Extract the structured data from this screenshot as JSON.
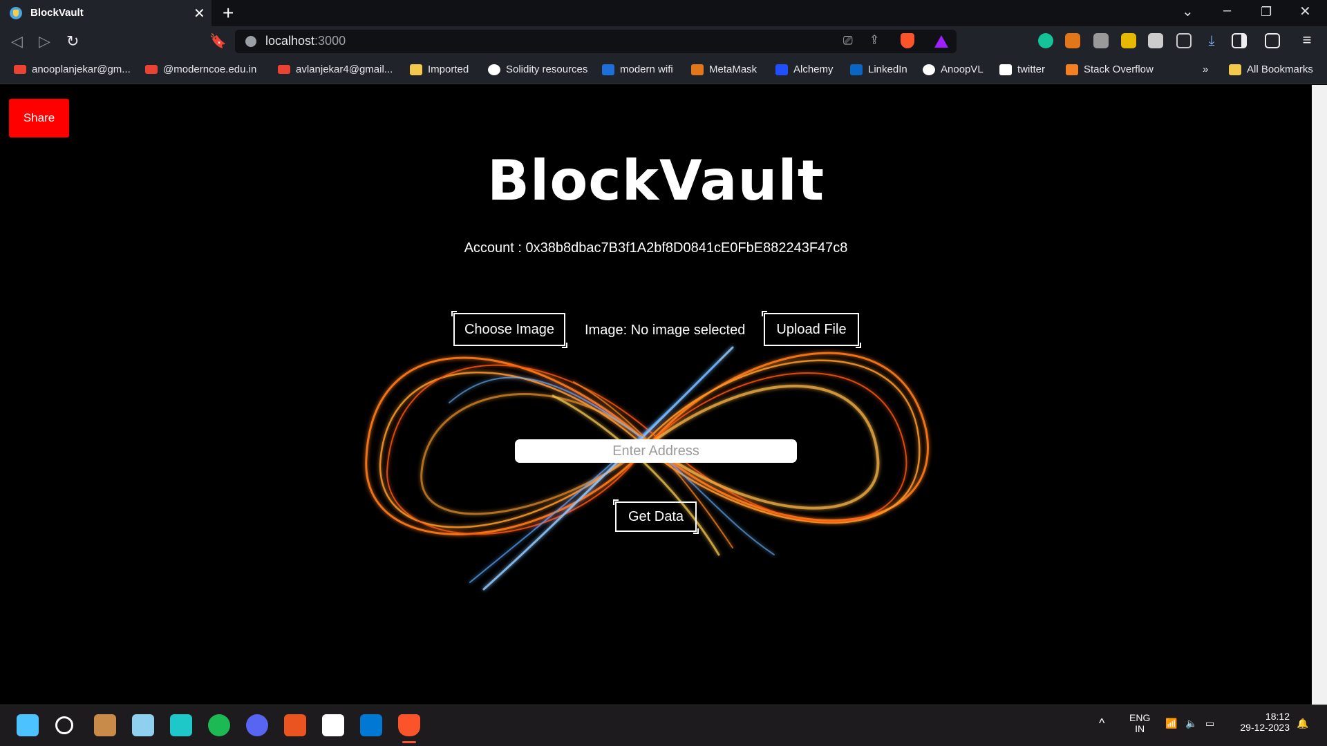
{
  "browser": {
    "tab_title": "BlockVault",
    "url_host": "localhost",
    "url_port": ":3000",
    "bookmarks": [
      "anooplanjekar@gm...",
      "@moderncoe.edu.in",
      "avlanjekar4@gmail...",
      "Imported",
      "Solidity resources",
      "modern wifi",
      "MetaMask",
      "Alchemy",
      "LinkedIn",
      "AnoopVL",
      "twitter",
      "Stack Overflow",
      "All Bookmarks"
    ],
    "more_bookmarks": "»"
  },
  "page": {
    "share_label": "Share",
    "brand": "BlockVault",
    "account_text": "Account : 0x38b8dbac7B3f1A2bf8D0841cE0FbE882243F47c8",
    "choose_image_label": "Choose Image",
    "image_status": "Image: No image selected",
    "upload_label": "Upload File",
    "address_placeholder": "Enter Address",
    "get_data_label": "Get Data"
  },
  "taskbar": {
    "lang": "ENG",
    "region": "IN",
    "time": "18:12",
    "date": "29-12-2023"
  },
  "colors": {
    "share_bg": "#ff0000",
    "accent_orange": "#ff8c1a",
    "accent_blue": "#6fb8ff"
  }
}
